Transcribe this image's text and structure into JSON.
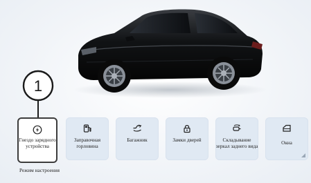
{
  "callout": {
    "number": "1"
  },
  "tiles": [
    {
      "label": "Гнездо зарядного устройства",
      "icon": "charging-port-icon"
    },
    {
      "label": "Заправочная горловина",
      "icon": "fuel-filler-icon"
    },
    {
      "label": "Багажник",
      "icon": "trunk-icon"
    },
    {
      "label": "Замки дверей",
      "icon": "door-lock-icon"
    },
    {
      "label": "Складывание зеркал заднего вида",
      "icon": "mirror-fold-icon"
    },
    {
      "label": "Окна",
      "icon": "window-icon"
    }
  ],
  "footer": {
    "mode_label": "Режим настроения"
  },
  "colors": {
    "tile_bg": "#e0e9f3",
    "selected_border": "#3c3c3c",
    "car_body": "#111111"
  }
}
